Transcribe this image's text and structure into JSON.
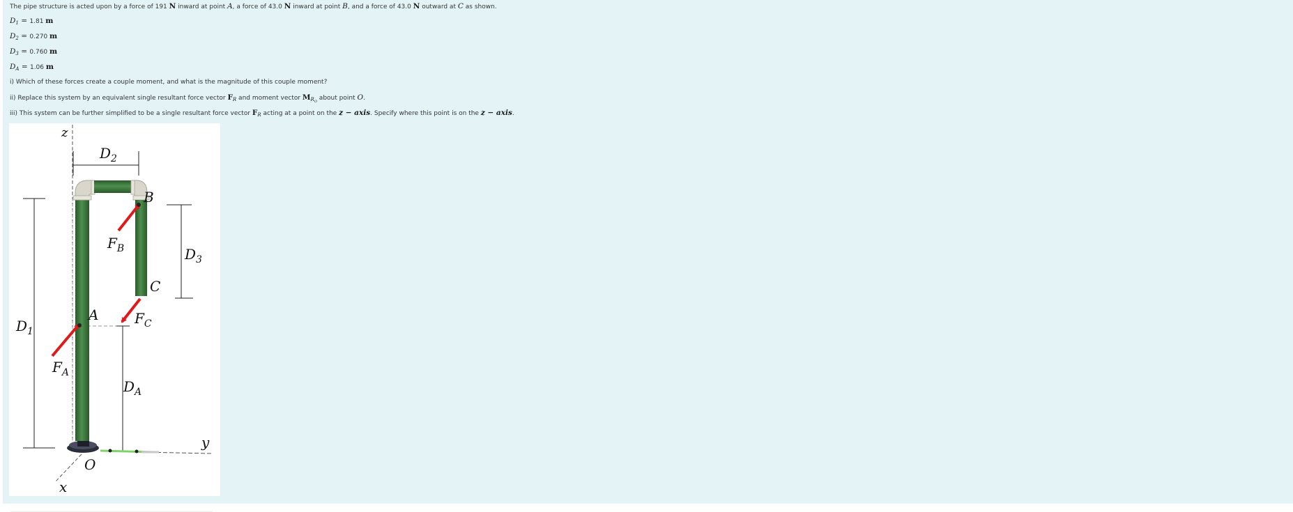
{
  "problem": {
    "intro": {
      "t1": "The pipe structure is acted upon by a force of ",
      "force_a": "191",
      "unit_n1": "N",
      "t2": " inward at point ",
      "pt_a": "A",
      "t3": ", a force of ",
      "force_b": "43.0",
      "unit_n2": "N",
      "t4": " inward at point ",
      "pt_b": "B",
      "t5": ", and a force of ",
      "force_c": "43.0",
      "unit_n3": "N",
      "t6": " outward at ",
      "pt_c": "C",
      "t7": " as shown."
    },
    "dimensions": [
      {
        "sym": "D",
        "sub": "1",
        "eq": " = ",
        "value": "1.81",
        "unit": "m"
      },
      {
        "sym": "D",
        "sub": "2",
        "eq": " = ",
        "value": "0.270",
        "unit": "m"
      },
      {
        "sym": "D",
        "sub": "3",
        "eq": " = ",
        "value": "0.760",
        "unit": "m"
      },
      {
        "sym": "D",
        "sub": "A",
        "eq": " = ",
        "value": "1.06",
        "unit": "m"
      }
    ],
    "q1": "i) Which of these forces create a couple moment, and what is the magnitude of this couple moment?",
    "q2": {
      "t1": "ii) Replace this system by an equivalent single resultant force vector ",
      "fr_sym": "F",
      "fr_sub": "R",
      "t2": " and moment vector ",
      "m_sym": "M",
      "m_sub": "R",
      "m_subsub": "O",
      "t3": " about point ",
      "pt_o": "O",
      "t4": "."
    },
    "q3": {
      "t1": "iii) This system can be further simplified to be a single resultant force vector ",
      "fr_sym": "F",
      "fr_sub": "R",
      "t2": " acting at a point on the ",
      "axis1": "z − axis",
      "t3": ". Specify where this point is on the ",
      "axis2": "z − axis",
      "t4": "."
    }
  },
  "figure": {
    "labels": {
      "z": "z",
      "y": "y",
      "x": "x",
      "o": "O",
      "a": "A",
      "b": "B",
      "c": "C",
      "d": "D",
      "sub_1": "1",
      "sub_2": "2",
      "sub_3": "3",
      "sub_a": "A",
      "f": "F",
      "fsub_a": "A",
      "fsub_b": "B",
      "fsub_c": "C"
    },
    "colors": {
      "pipe": "#3d7a3d",
      "pipe_dark": "#2a5a2a",
      "elbow": "#d9d6cc",
      "force_arrow": "#e0191b",
      "y_axis_green": "#7fd36a",
      "panel_bg": "#e4f4f6"
    }
  }
}
